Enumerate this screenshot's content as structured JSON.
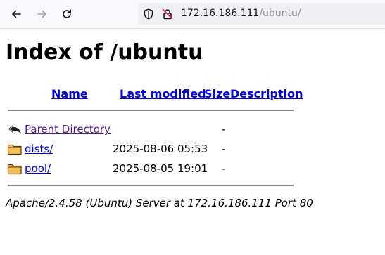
{
  "browser": {
    "url_host": "172.16.186.111",
    "url_path": "/ubuntu/"
  },
  "page": {
    "title": "Index of /ubuntu",
    "columns": {
      "name": "Name",
      "last_modified": "Last modified",
      "size": "Size",
      "description": "Description"
    },
    "rows": [
      {
        "name": "Parent Directory",
        "last_modified": "",
        "size": "-",
        "icon": "back-arrow-icon"
      },
      {
        "name": "dists/",
        "last_modified": "2025-08-06 05:53",
        "size": "-",
        "icon": "folder-icon"
      },
      {
        "name": "pool/",
        "last_modified": "2025-08-05 19:01",
        "size": "-",
        "icon": "folder-icon"
      }
    ],
    "footer": "Apache/2.4.58 (Ubuntu) Server at 172.16.186.111 Port 80"
  }
}
